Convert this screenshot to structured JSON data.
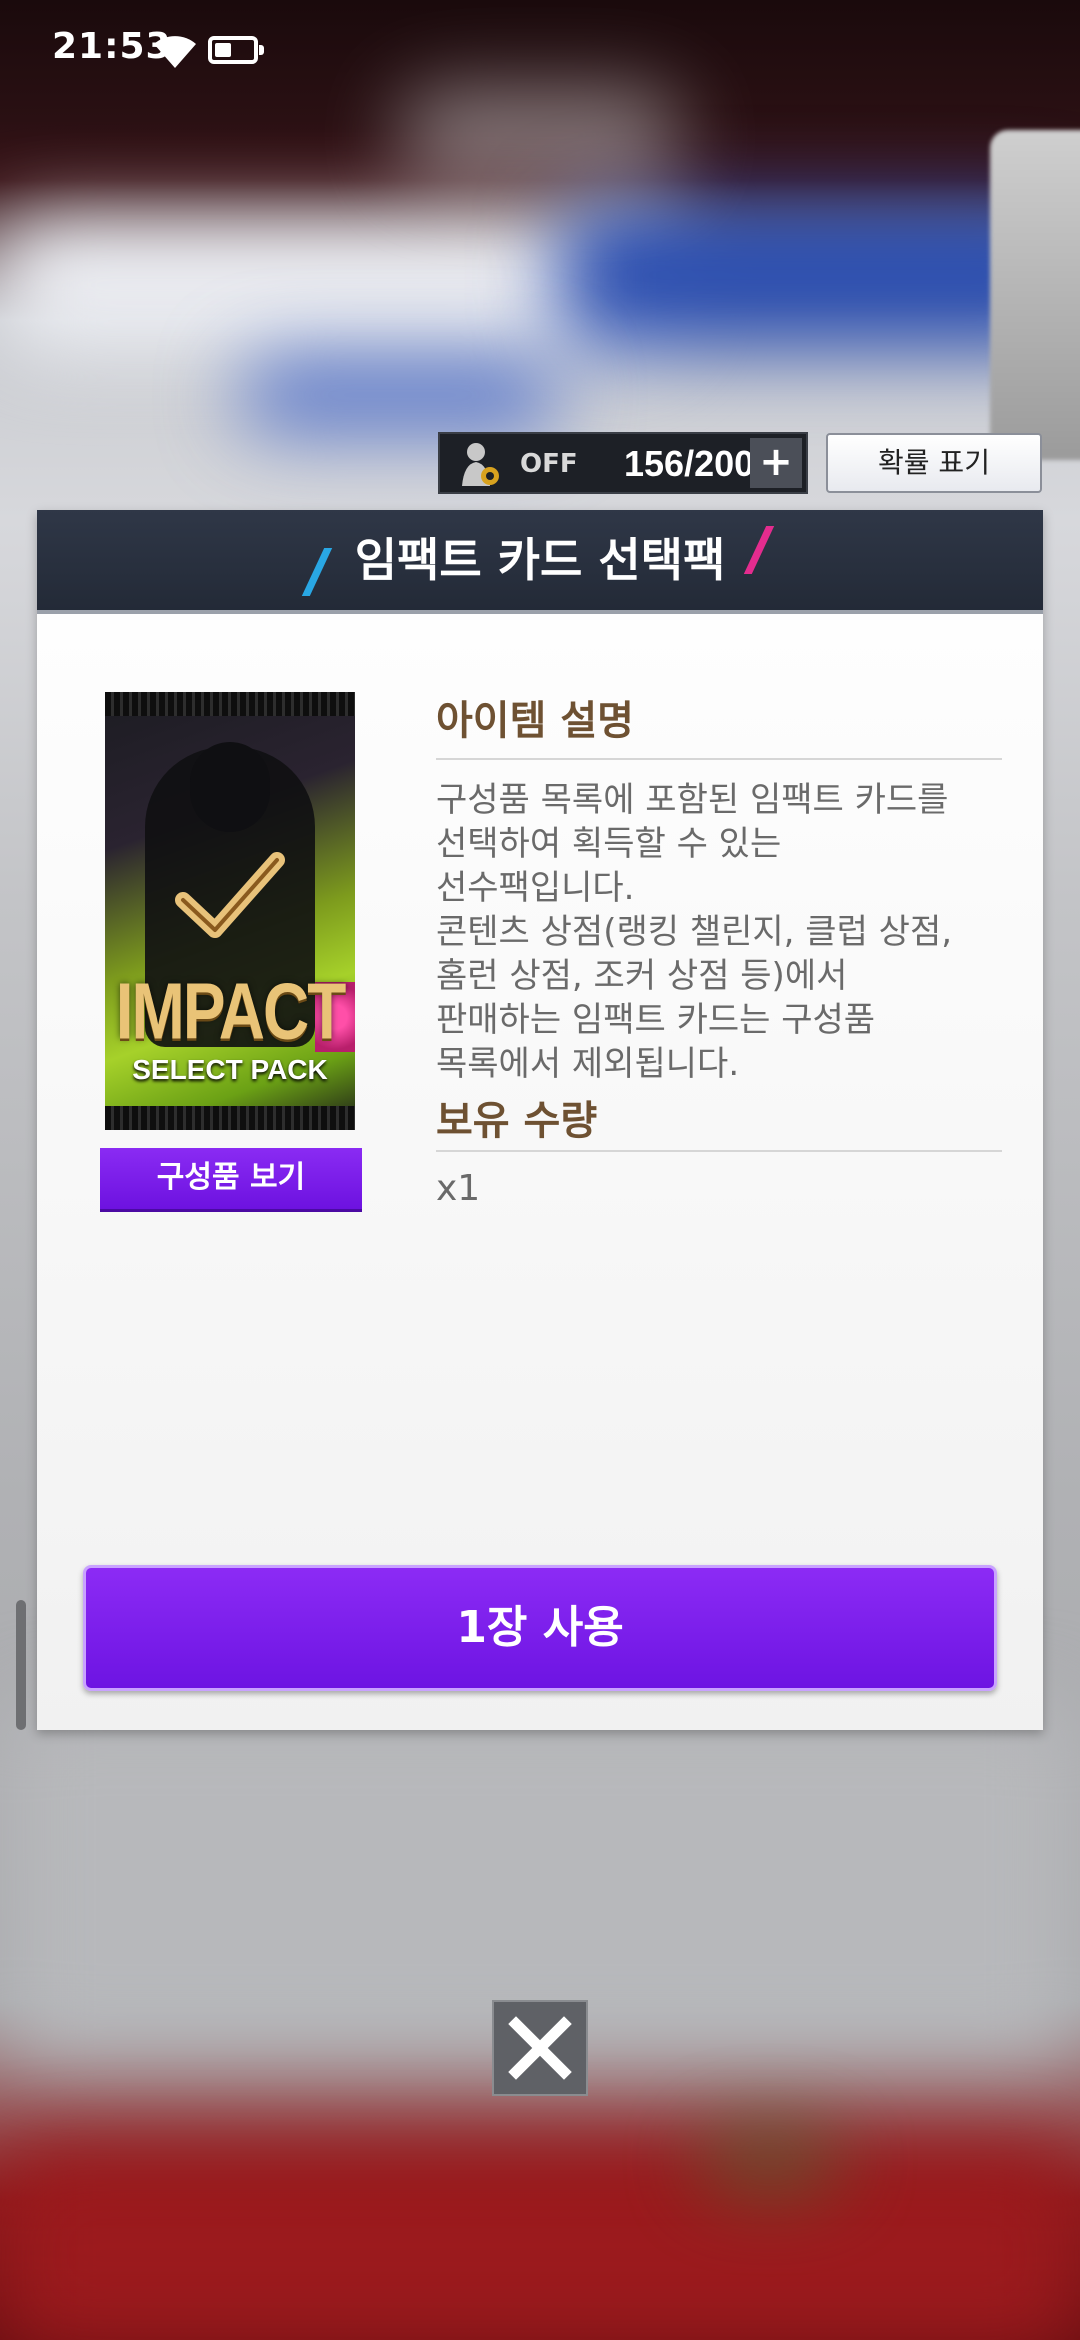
{
  "status_bar": {
    "time": "21:53"
  },
  "auto_panel": {
    "status": "OFF",
    "count": "156/200",
    "plus": "+"
  },
  "prob_button": "확률 표기",
  "dialog": {
    "title": "임팩트 카드 선택팩",
    "pack": {
      "main": "IMPACT",
      "sub": "SELECT PACK"
    },
    "compose_button": "구성품 보기",
    "desc_title": "아이템 설명",
    "desc_text": "구성품 목록에 포함된 임팩트 카드를\n선택하여 획득할 수 있는\n선수팩입니다.\n콘텐츠 상점(랭킹 챌린지, 클럽 상점,\n홈런 상점, 조커 상점 등)에서\n판매하는 임팩트 카드는 구성품\n목록에서 제외됩니다.",
    "own_title": "보유 수량",
    "own_value": "x1",
    "use_button": "1장 사용"
  },
  "colors": {
    "header": "#2f3747",
    "accent_purple": "#7a1de9",
    "section_title": "#6e5132"
  }
}
